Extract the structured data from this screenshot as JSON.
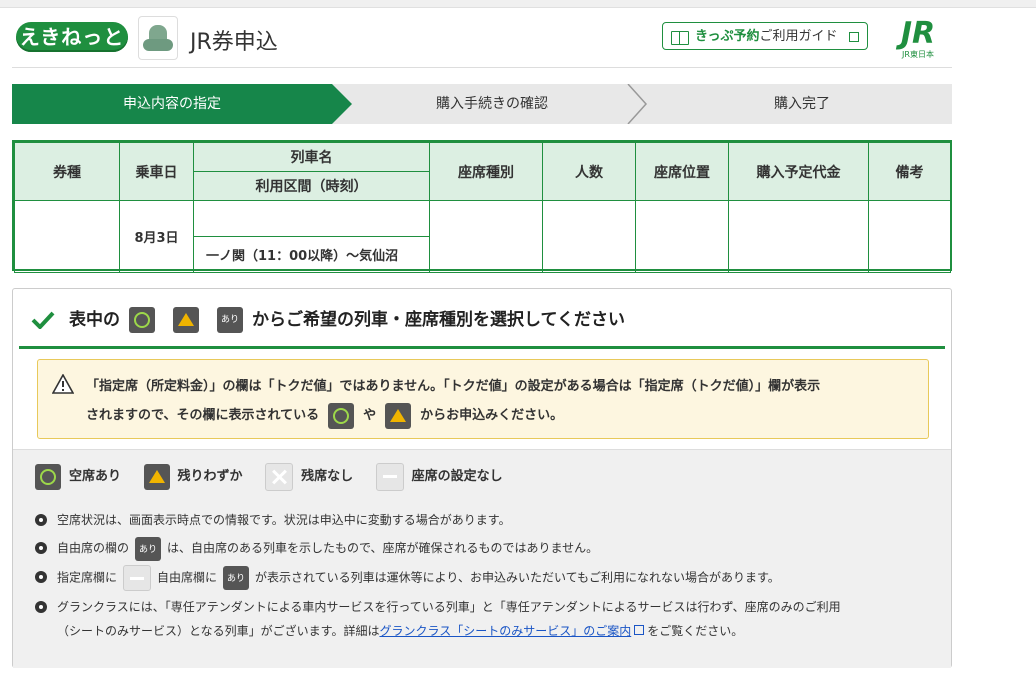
{
  "header": {
    "logo_text": "えきねっと",
    "app_title": "JR券申込",
    "guide_link_bold": "きっぷ予約",
    "guide_link_rest": "ご利用ガイド",
    "jr_logo": "JR",
    "jr_sub": "JR東日本"
  },
  "steps": [
    "申込内容の指定",
    "購入手続きの確認",
    "購入完了"
  ],
  "table": {
    "headers": {
      "type": "券種",
      "date": "乗車日",
      "train": "列車名",
      "section": "利用区間（時刻）",
      "seat_class": "座席種別",
      "people": "人数",
      "seat_pos": "座席位置",
      "price": "購入予定代金",
      "remarks": "備考"
    },
    "row": {
      "date": "8月3日",
      "section": "一ノ関（11：00以降）〜気仙沼"
    }
  },
  "panel": {
    "head_prefix": "表中の",
    "head_suffix": "からご希望の列車・座席種別を選択してください",
    "ari_label": "あり",
    "notice_line1": "「指定席（所定料金）」の欄は「トクだ値」ではありません。「トクだ値」の設定がある場合は「指定席（トクだ値）」欄が表示",
    "notice_line2a": "されますので、その欄に表示されている",
    "notice_ya": "や",
    "notice_line2b": "からお申込みください。",
    "legend": {
      "available": "空席あり",
      "few": "残りわずか",
      "none": "残席なし",
      "no_setting": "座席の設定なし"
    },
    "notes": {
      "n1": "空席状況は、画面表示時点での情報です。状況は申込中に変動する場合があります。",
      "n2a": "自由席の欄の",
      "n2b": "は、自由席のある列車を示したもので、座席が確保されるものではありません。",
      "n3a": "指定席欄に",
      "n3b": "自由席欄に",
      "n3c": "が表示されている列車は運休等により、お申込みいただいてもご利用になれない場合があります。",
      "n4a": "グランクラスには、「専任アテンダントによる車内サービスを行っている列車」と「専任アテンダントによるサービスは行わず、座席のみのご利用",
      "n4b": "（シートのみサービス）となる列車」がございます。詳細は",
      "n4link": "グランクラス「シートのみサービス」のご案内",
      "n4c": "をご覧ください。"
    }
  },
  "colors": {
    "brand_green": "#1f8f3f",
    "step_active": "#16864a",
    "notice_bg": "#fdf6e0"
  }
}
